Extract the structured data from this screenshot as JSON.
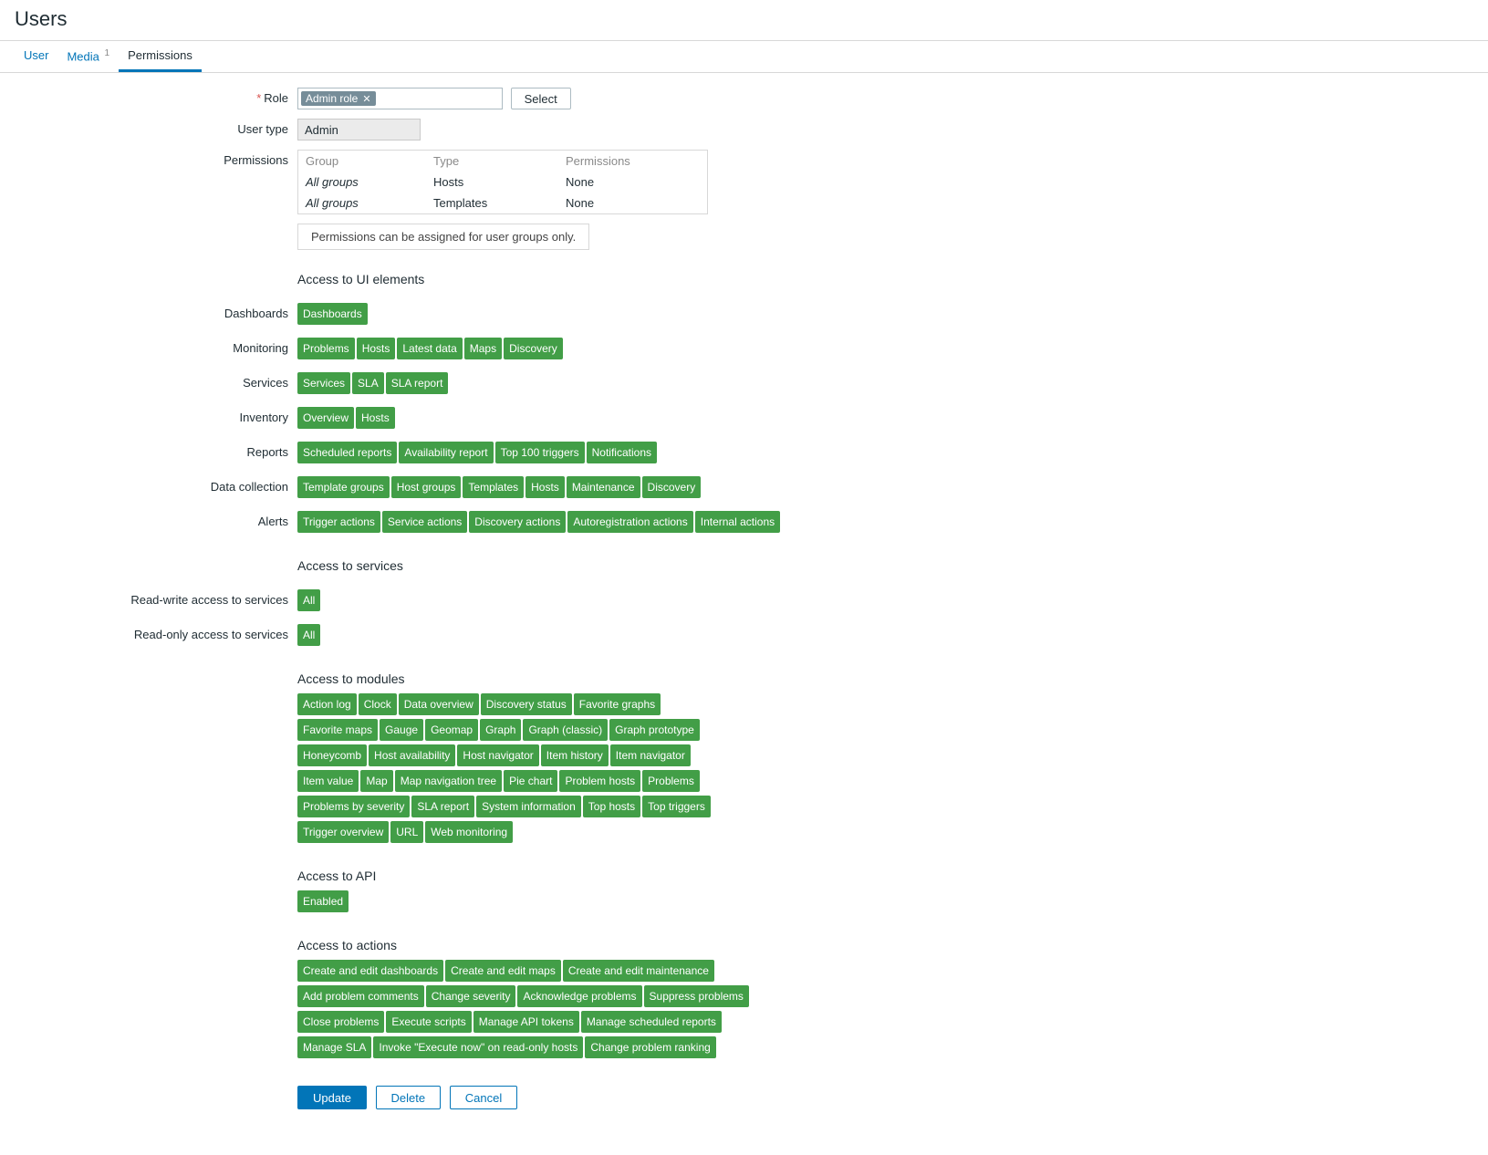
{
  "page": {
    "title": "Users"
  },
  "tabs": {
    "user": "User",
    "media": "Media",
    "media_count": "1",
    "permissions": "Permissions"
  },
  "labels": {
    "role": "Role",
    "user_type": "User type",
    "permissions": "Permissions",
    "dashboards": "Dashboards",
    "monitoring": "Monitoring",
    "services": "Services",
    "inventory": "Inventory",
    "reports": "Reports",
    "data_collection": "Data collection",
    "alerts": "Alerts",
    "rw_services": "Read-write access to services",
    "ro_services": "Read-only access to services"
  },
  "role": {
    "tag": "Admin role",
    "select_btn": "Select"
  },
  "user_type_value": "Admin",
  "perm_table": {
    "h_group": "Group",
    "h_type": "Type",
    "h_perm": "Permissions",
    "r1_group": "All groups",
    "r1_type": "Hosts",
    "r1_perm": "None",
    "r2_group": "All groups",
    "r2_type": "Templates",
    "r2_perm": "None"
  },
  "perm_note": "Permissions can be assigned for user groups only.",
  "sections": {
    "ui": "Access to UI elements",
    "services": "Access to services",
    "modules": "Access to modules",
    "api": "Access to API",
    "actions": "Access to actions"
  },
  "ui": {
    "dashboards": [
      "Dashboards"
    ],
    "monitoring": [
      "Problems",
      "Hosts",
      "Latest data",
      "Maps",
      "Discovery"
    ],
    "services": [
      "Services",
      "SLA",
      "SLA report"
    ],
    "inventory": [
      "Overview",
      "Hosts"
    ],
    "reports": [
      "Scheduled reports",
      "Availability report",
      "Top 100 triggers",
      "Notifications"
    ],
    "data_collection": [
      "Template groups",
      "Host groups",
      "Templates",
      "Hosts",
      "Maintenance",
      "Discovery"
    ],
    "alerts": [
      "Trigger actions",
      "Service actions",
      "Discovery actions",
      "Autoregistration actions",
      "Internal actions"
    ]
  },
  "svc": {
    "rw": "All",
    "ro": "All"
  },
  "modules": [
    "Action log",
    "Clock",
    "Data overview",
    "Discovery status",
    "Favorite graphs",
    "Favorite maps",
    "Gauge",
    "Geomap",
    "Graph",
    "Graph (classic)",
    "Graph prototype",
    "Honeycomb",
    "Host availability",
    "Host navigator",
    "Item history",
    "Item navigator",
    "Item value",
    "Map",
    "Map navigation tree",
    "Pie chart",
    "Problem hosts",
    "Problems",
    "Problems by severity",
    "SLA report",
    "System information",
    "Top hosts",
    "Top triggers",
    "Trigger overview",
    "URL",
    "Web monitoring"
  ],
  "api": [
    "Enabled"
  ],
  "actions": [
    "Create and edit dashboards",
    "Create and edit maps",
    "Create and edit maintenance",
    "Add problem comments",
    "Change severity",
    "Acknowledge problems",
    "Suppress problems",
    "Close problems",
    "Execute scripts",
    "Manage API tokens",
    "Manage scheduled reports",
    "Manage SLA",
    "Invoke \"Execute now\" on read-only hosts",
    "Change problem ranking"
  ],
  "buttons": {
    "update": "Update",
    "delete": "Delete",
    "cancel": "Cancel"
  }
}
